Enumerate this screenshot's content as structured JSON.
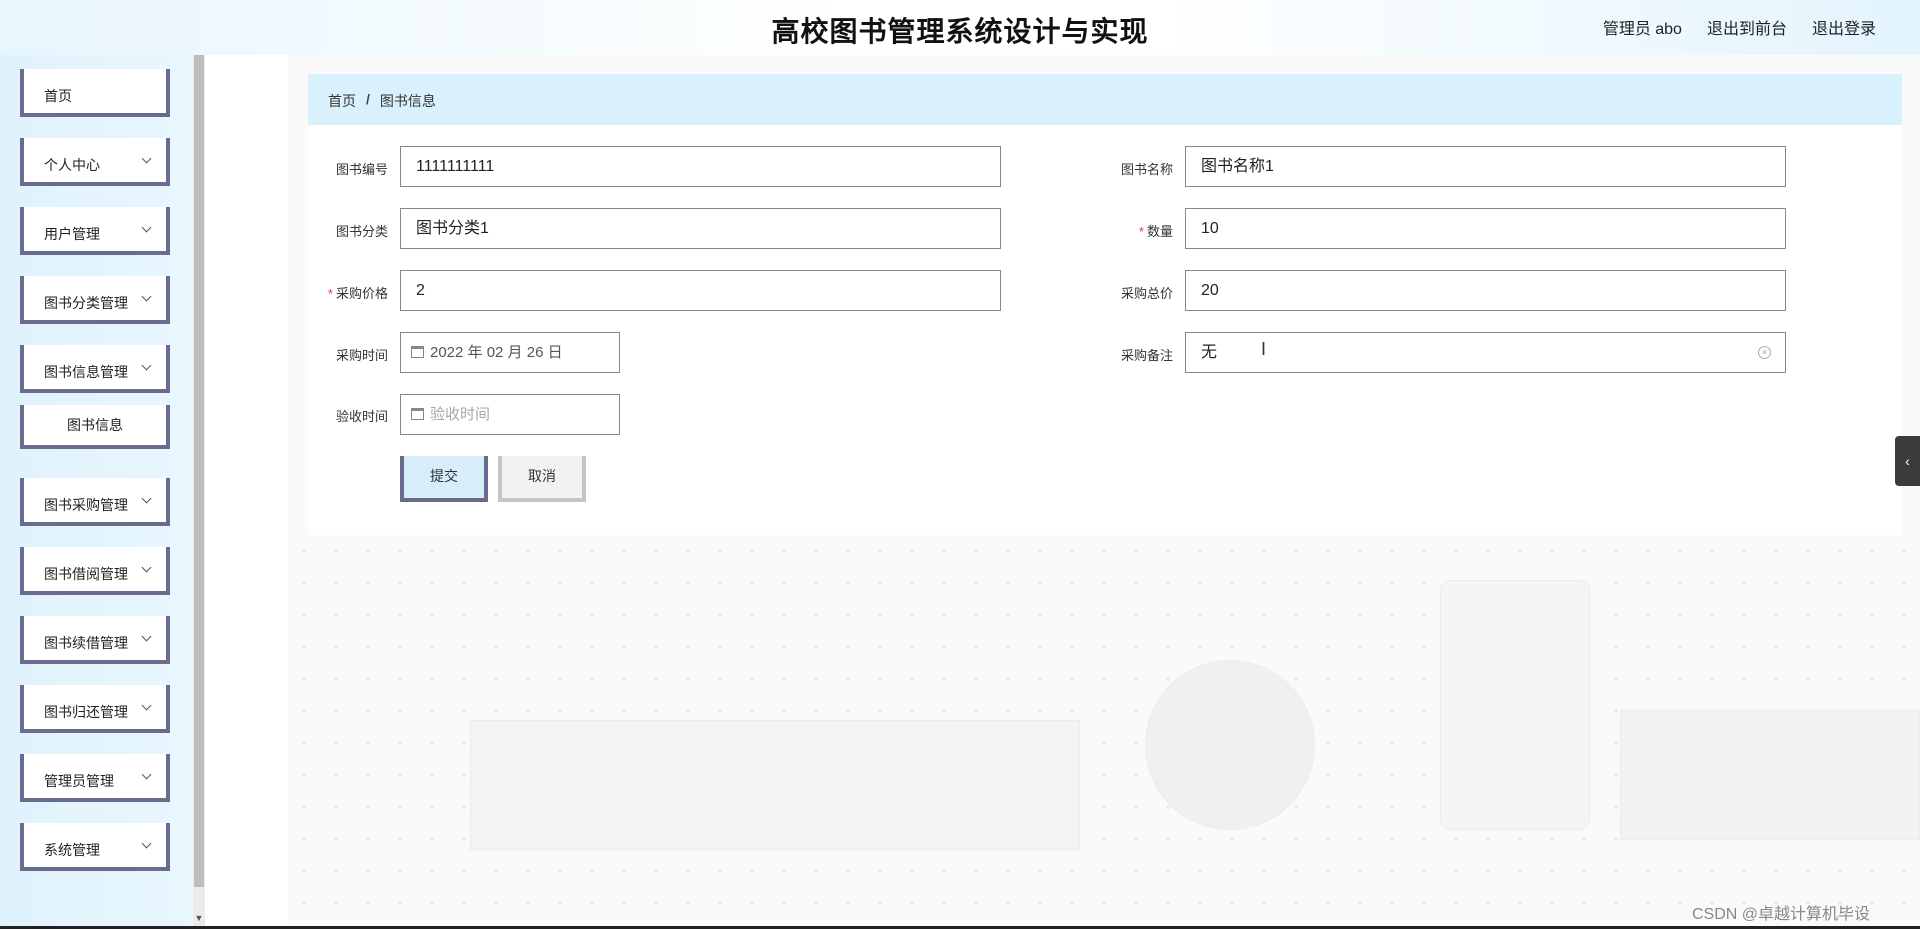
{
  "header": {
    "title": "高校图书管理系统设计与实现",
    "user_label": "管理员 abo",
    "exit_front": "退出到前台",
    "logout": "退出登录"
  },
  "sidebar": {
    "items": [
      {
        "label": "首页"
      },
      {
        "label": "个人中心"
      },
      {
        "label": "用户管理"
      },
      {
        "label": "图书分类管理"
      },
      {
        "label": "图书信息管理"
      },
      {
        "label": "图书信息"
      },
      {
        "label": "图书采购管理"
      },
      {
        "label": "图书借阅管理"
      },
      {
        "label": "图书续借管理"
      },
      {
        "label": "图书归还管理"
      },
      {
        "label": "管理员管理"
      },
      {
        "label": "系统管理"
      }
    ]
  },
  "breadcrumb": {
    "home": "首页",
    "separator": "/",
    "current": "图书信息"
  },
  "form": {
    "book_no": {
      "label": "图书编号",
      "value": "1111111111"
    },
    "book_name": {
      "label": "图书名称",
      "value": "图书名称1"
    },
    "category": {
      "label": "图书分类",
      "value": "图书分类1"
    },
    "quantity": {
      "label": "数量",
      "value": "10",
      "required": "*"
    },
    "price": {
      "label": "采购价格",
      "value": "2",
      "required": "*"
    },
    "total": {
      "label": "采购总价",
      "value": "20"
    },
    "purchase_time": {
      "label": "采购时间",
      "value": "2022 年 02 月 26 日"
    },
    "remark": {
      "label": "采购备注",
      "value": "无"
    },
    "accept_time": {
      "label": "验收时间",
      "placeholder": "验收时间"
    },
    "submit": "提交",
    "cancel": "取消"
  },
  "watermark": "CSDN @卓越计算机毕设"
}
